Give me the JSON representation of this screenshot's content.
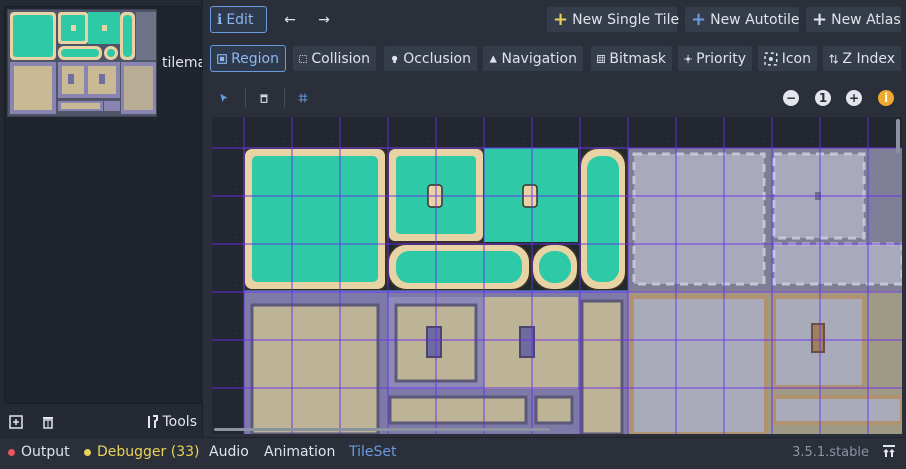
{
  "left": {
    "tile_name": "tilema",
    "tools_label": "Tools"
  },
  "toolbar1": {
    "edit_label": "Edit",
    "back_label": "←",
    "forward_label": "→",
    "new_single_tile": "New Single Tile",
    "new_autotile": "New Autotile",
    "new_atlas": "New Atlas"
  },
  "toolbar2": {
    "tabs": [
      "Region",
      "Collision",
      "Occlusion",
      "Navigation",
      "Bitmask",
      "Priority",
      "Icon",
      "Z Index"
    ],
    "active": "Region"
  },
  "toolbar3": {
    "zoom_reset_label": "1"
  },
  "bottom": {
    "output": "Output",
    "debugger": "Debugger (33)",
    "audio": "Audio",
    "animation": "Animation",
    "tileset": "TileSet",
    "version": "3.5.1.stable"
  },
  "colors": {
    "accent": "#6a9be0",
    "grid": "#6a2cf0",
    "water": "#2ec9a6",
    "sand": "#e7d3a3",
    "error_dot": "#e8555a",
    "warn_dot": "#e8d35a"
  },
  "icons": [
    "pencil-icon",
    "arrow-left-icon",
    "arrow-right-icon",
    "plus-icon",
    "region-icon",
    "collision-icon",
    "occlusion-icon",
    "navigation-icon",
    "bitmask-icon",
    "priority-icon",
    "icon-icon",
    "zindex-icon",
    "select-arrow-icon",
    "trash-icon",
    "grid-icon",
    "zoom-out-icon",
    "zoom-in-icon",
    "info-icon",
    "add-icon",
    "tools-icon",
    "pin-icon"
  ]
}
